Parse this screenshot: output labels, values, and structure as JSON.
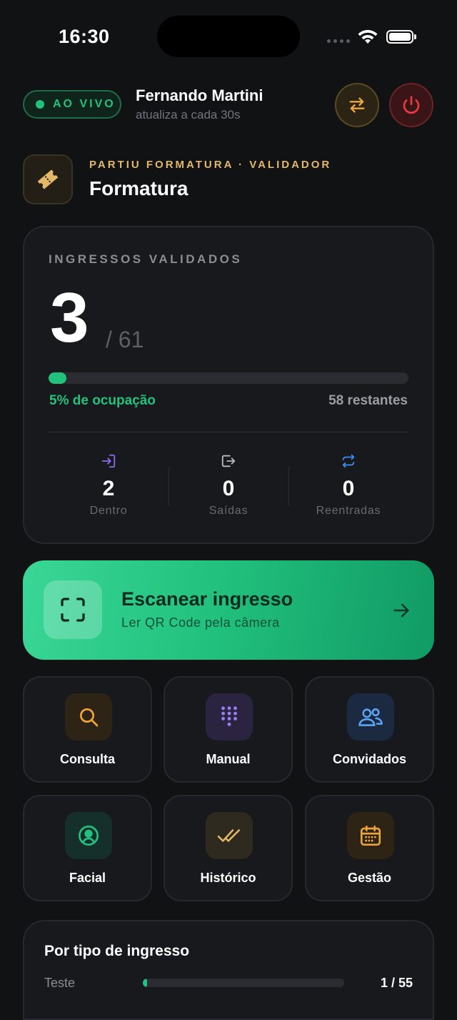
{
  "status_bar": {
    "time": "16:30"
  },
  "header": {
    "live_label": "AO VIVO",
    "user_name": "Fernando Martini",
    "refresh_note": "atualiza a cada 30s"
  },
  "event": {
    "kicker": "PARTIU FORMATURA · VALIDADOR",
    "title": "Formatura"
  },
  "stats": {
    "label": "INGRESSOS VALIDADOS",
    "validated": "3",
    "total": "/ 61",
    "occupancy_fraction": 0.05,
    "occupancy_text": "5% de ocupação",
    "remaining_text": "58 restantes",
    "breakdown": [
      {
        "value": "2",
        "label": "Dentro",
        "icon": "enter-icon",
        "color": "#8b6cf0"
      },
      {
        "value": "0",
        "label": "Saídas",
        "icon": "exit-icon",
        "color": "#b8bbc2"
      },
      {
        "value": "0",
        "label": "Reentradas",
        "icon": "reentry-icon",
        "color": "#3b8cf0"
      }
    ]
  },
  "scan": {
    "title": "Escanear ingresso",
    "subtitle": "Ler QR Code pela câmera"
  },
  "actions": [
    {
      "label": "Consulta",
      "icon": "search-icon",
      "color": "#f0a63a"
    },
    {
      "label": "Manual",
      "icon": "keypad-icon",
      "color": "#9a7cf5"
    },
    {
      "label": "Convidados",
      "icon": "users-icon",
      "color": "#5aa5f5"
    },
    {
      "label": "Facial",
      "icon": "face-icon",
      "color": "#22c27e"
    },
    {
      "label": "Histórico",
      "icon": "double-check-icon",
      "color": "#e3b869"
    },
    {
      "label": "Gestão",
      "icon": "calendar-icon",
      "color": "#f0a63a"
    }
  ],
  "ticket_types": {
    "title": "Por tipo de ingresso",
    "items": [
      {
        "name": "Teste",
        "count": "1 / 55",
        "fraction": 0.018
      }
    ]
  },
  "colors": {
    "accent": "#22c27e",
    "danger": "#e53b40",
    "gold": "#e3b869"
  }
}
